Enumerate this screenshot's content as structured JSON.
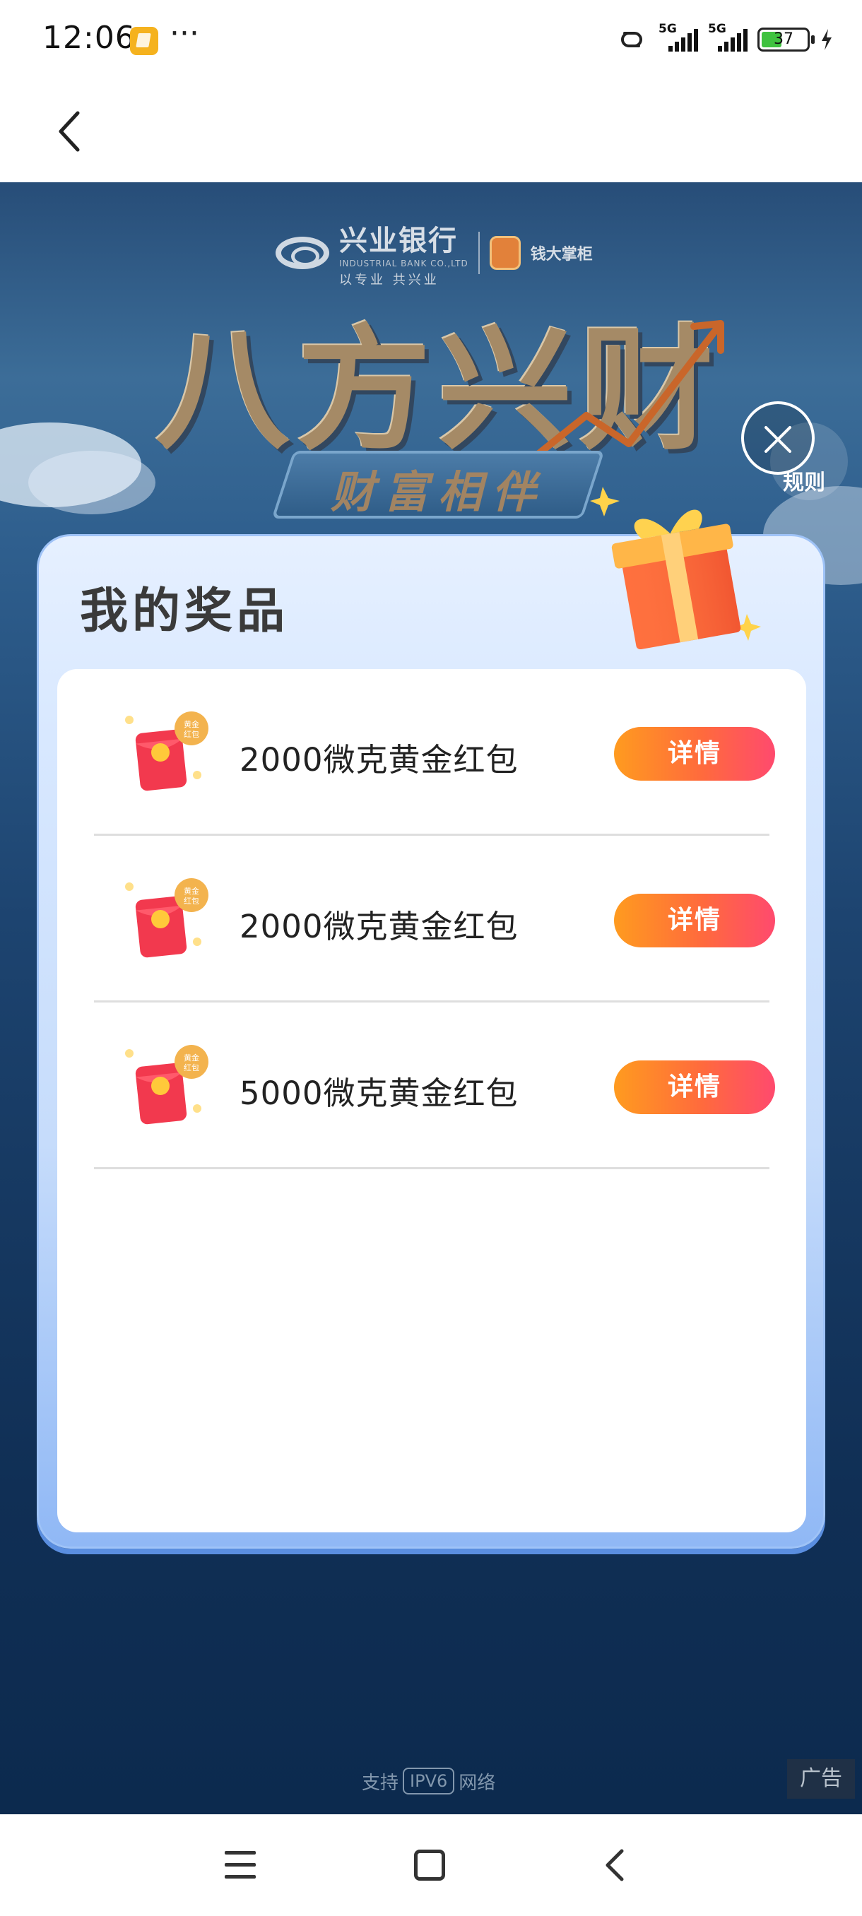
{
  "status_bar": {
    "time": "12:06",
    "more": "···",
    "signal_1": "5G",
    "signal_2": "5G",
    "battery": "37"
  },
  "hero": {
    "bank_name": "兴业银行",
    "bank_sub": "INDUSTRIAL BANK CO.,LTD",
    "bank_slogan": "以专业 共兴业",
    "app_name": "钱大掌柜",
    "title": "八方兴财",
    "subtitle": "财富相伴",
    "rules_label": "规则"
  },
  "modal": {
    "title": "我的奖品",
    "prizes": [
      {
        "name": "2000微克黄金红包",
        "button": "详情",
        "badge": "黄金红包"
      },
      {
        "name": "2000微克黄金红包",
        "button": "详情",
        "badge": "黄金红包"
      },
      {
        "name": "5000微克黄金红包",
        "button": "详情",
        "badge": "黄金红包"
      }
    ]
  },
  "footer": {
    "support": "支持",
    "ipv6": "IPV6",
    "network": "网络",
    "ad": "广告"
  },
  "icons": [
    "back-arrow-icon",
    "close-icon",
    "gift-box-icon",
    "red-packet-icon",
    "menu-icon",
    "home-icon",
    "system-back-icon"
  ]
}
